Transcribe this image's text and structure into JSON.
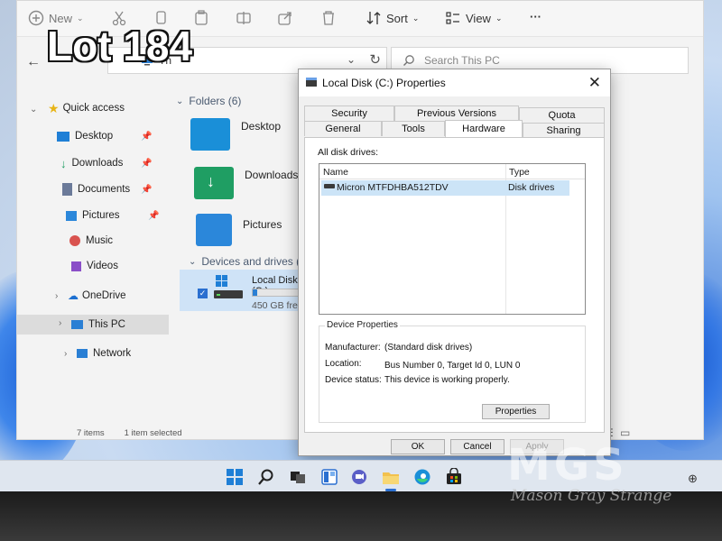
{
  "overlay": {
    "lot_text": "Lot 184",
    "watermark_logo": "MGS",
    "watermark_name": "Mason Gray Strange"
  },
  "explorer": {
    "toolbar": {
      "new_label": "New",
      "sort_label": "Sort",
      "view_label": "View",
      "more_label": "···"
    },
    "address": {
      "path_text": "Th",
      "search_placeholder": "Search This PC"
    },
    "nav": {
      "quick_access": "Quick access",
      "items": [
        {
          "label": "Desktop",
          "icon": "desktop-icon",
          "pinned": true
        },
        {
          "label": "Downloads",
          "icon": "download-icon",
          "pinned": true
        },
        {
          "label": "Documents",
          "icon": "document-icon",
          "pinned": true
        },
        {
          "label": "Pictures",
          "icon": "picture-icon",
          "pinned": true
        },
        {
          "label": "Music",
          "icon": "music-icon",
          "pinned": false
        },
        {
          "label": "Videos",
          "icon": "video-icon",
          "pinned": false
        }
      ],
      "onedrive": "OneDrive",
      "this_pc": "This PC",
      "network": "Network"
    },
    "content": {
      "folders_header": "Folders (6)",
      "folders": [
        {
          "label": "Desktop",
          "color": "#1a8fd8"
        },
        {
          "label": "Downloads",
          "color": "#1f9e63"
        },
        {
          "label": "Pictures",
          "color": "#2b87da"
        }
      ],
      "devices_header": "Devices and drives (1)",
      "drive": {
        "label": "Local Disk (C:)",
        "free": "450 GB free of",
        "used_fraction": 0.08
      }
    },
    "status": {
      "item_count": "7 items",
      "selected": "1 item selected"
    }
  },
  "dialog": {
    "title": "Local Disk (C:) Properties",
    "tabs_row1": [
      "Security",
      "Previous Versions",
      "Quota"
    ],
    "tabs_row2": [
      "General",
      "Tools",
      "Hardware",
      "Sharing"
    ],
    "active_tab": "Hardware",
    "all_disk_drives_label": "All disk drives:",
    "columns": {
      "name": "Name",
      "type": "Type"
    },
    "drives": [
      {
        "name": "Micron MTFDHBA512TDV",
        "type": "Disk drives"
      }
    ],
    "device_properties": {
      "title": "Device Properties",
      "manufacturer_label": "Manufacturer:",
      "manufacturer_value": "(Standard disk drives)",
      "location_label": "Location:",
      "location_value": "Bus Number 0, Target Id 0, LUN 0",
      "status_label": "Device status:",
      "status_value": "This device is working properly."
    },
    "buttons": {
      "properties": "Properties",
      "ok": "OK",
      "cancel": "Cancel",
      "apply": "Apply"
    }
  },
  "taskbar": {
    "icons": [
      "start-icon",
      "search-icon",
      "task-view-icon",
      "widgets-icon",
      "chat-icon",
      "file-explorer-icon",
      "edge-icon",
      "store-icon"
    ]
  }
}
